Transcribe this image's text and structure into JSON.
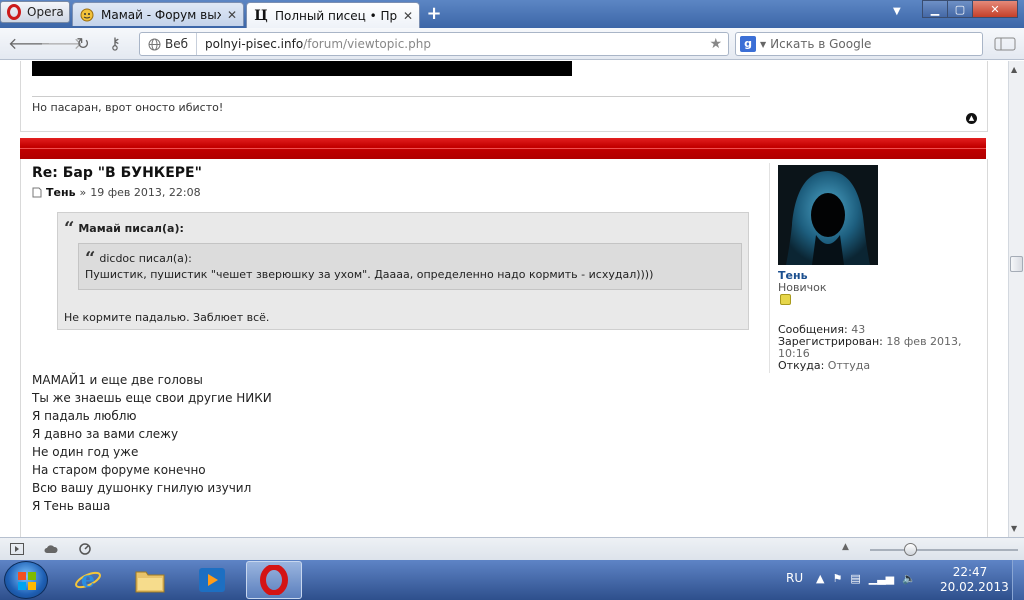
{
  "browser": {
    "opera_button": "Opera",
    "tabs": [
      {
        "title": "Мамай - Форум выжи...",
        "active": false
      },
      {
        "title": "Полный писец • Прос...",
        "active": true
      }
    ],
    "address": {
      "scope_label": "Веб",
      "url_domain": "polnyi-pisec.info",
      "url_path": "/forum/viewtopic.php"
    },
    "search_placeholder": "Искать в Google"
  },
  "page": {
    "prev_post_text": "Но пасаран, врот оносто ибисто!",
    "post": {
      "title": "Re: Бар \"В БУНКЕРЕ\"",
      "author": "Тень",
      "separator": "»",
      "date": "19 фев 2013, 22:08",
      "quote_outer_author": "Мамай писал(а):",
      "quote_inner_author": "dicdoc писал(а):",
      "quote_inner_text": "Пушистик, пушистик \"чешет зверюшку за ухом\". Даааа, определенно надо кормить - исхудал))))",
      "quote_outer_text": "Не кормите падалью. Заблюет всё.",
      "body_lines": [
        "МАМАЙ1 и еще две головы",
        "Ты же знаешь еще свои другие НИКИ",
        "Я падаль люблю",
        "Я давно за вами слежу",
        "Не один год уже",
        "На старом форуме конечно",
        "Всю вашу душонку гнилую изучил",
        "Я Тень ваша"
      ]
    },
    "profile": {
      "name": "Тень",
      "rank": "Новичок",
      "posts_label": "Сообщения:",
      "posts_value": "43",
      "registered_label": "Зарегистрирован:",
      "registered_value": "18 фев 2013, 10:16",
      "from_label": "Откуда:",
      "from_value": "Оттуда"
    }
  },
  "taskbar": {
    "lang": "RU",
    "time": "22:47",
    "date": "20.02.2013"
  },
  "colors": {
    "accent_red": "#c40000",
    "profile_link": "#1b4f8f"
  }
}
